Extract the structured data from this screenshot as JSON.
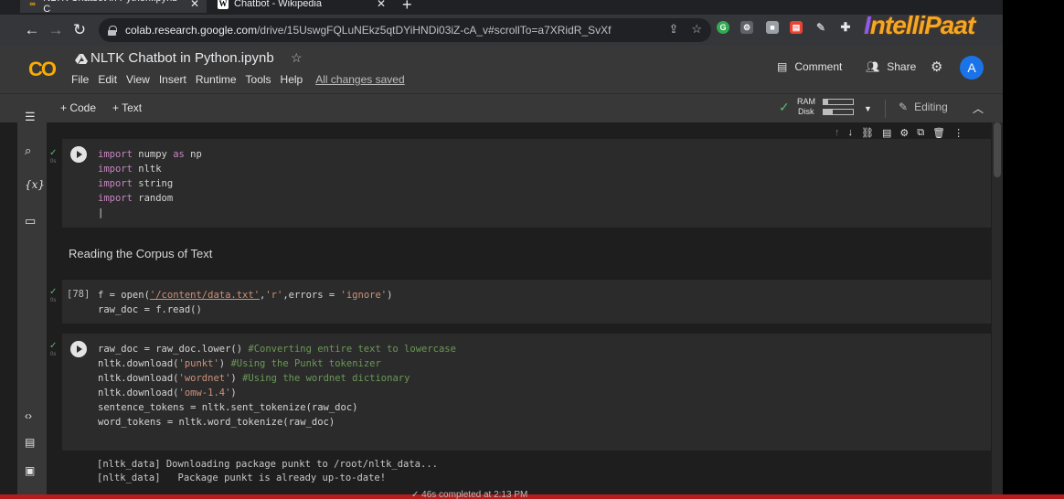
{
  "browser": {
    "tabs": [
      {
        "title": "NLTK Chatbot in Python.ipynb - C"
      },
      {
        "title": "Chatbot - Wikipedia"
      }
    ],
    "url_host": "colab.research.google.com",
    "url_path": "/drive/15UswgFQLuNEkz5qtDYiHNDi03iZ-cA_v#scrollTo=a7XRidR_SvXf",
    "watermark": "IntelliPaat"
  },
  "colab": {
    "logo": "CO",
    "title": "NLTK Chatbot in Python.ipynb",
    "menu": [
      "File",
      "Edit",
      "View",
      "Insert",
      "Runtime",
      "Tools",
      "Help"
    ],
    "saved_status": "All changes saved",
    "comment_label": "Comment",
    "share_label": "Share",
    "avatar_letter": "A",
    "toolbar": {
      "add_code": "+ Code",
      "add_text": "+ Text",
      "ram_label": "RAM",
      "disk_label": "Disk",
      "ram_usage": 0.15,
      "disk_usage": 0.3,
      "editing_label": "Editing"
    }
  },
  "cells": {
    "cell1": {
      "lines": [
        "import numpy as np",
        "import nltk",
        "import string",
        "import random"
      ]
    },
    "text1": "Reading the Corpus of Text",
    "cell2": {
      "count": "[78]"
    },
    "cell3": {},
    "output3": [
      "[nltk_data] Downloading package punkt to /root/nltk_data...",
      "[nltk_data]   Package punkt is already up-to-date!"
    ]
  },
  "status": {
    "text": "✓ 46s   completed at 2:13 PM"
  }
}
